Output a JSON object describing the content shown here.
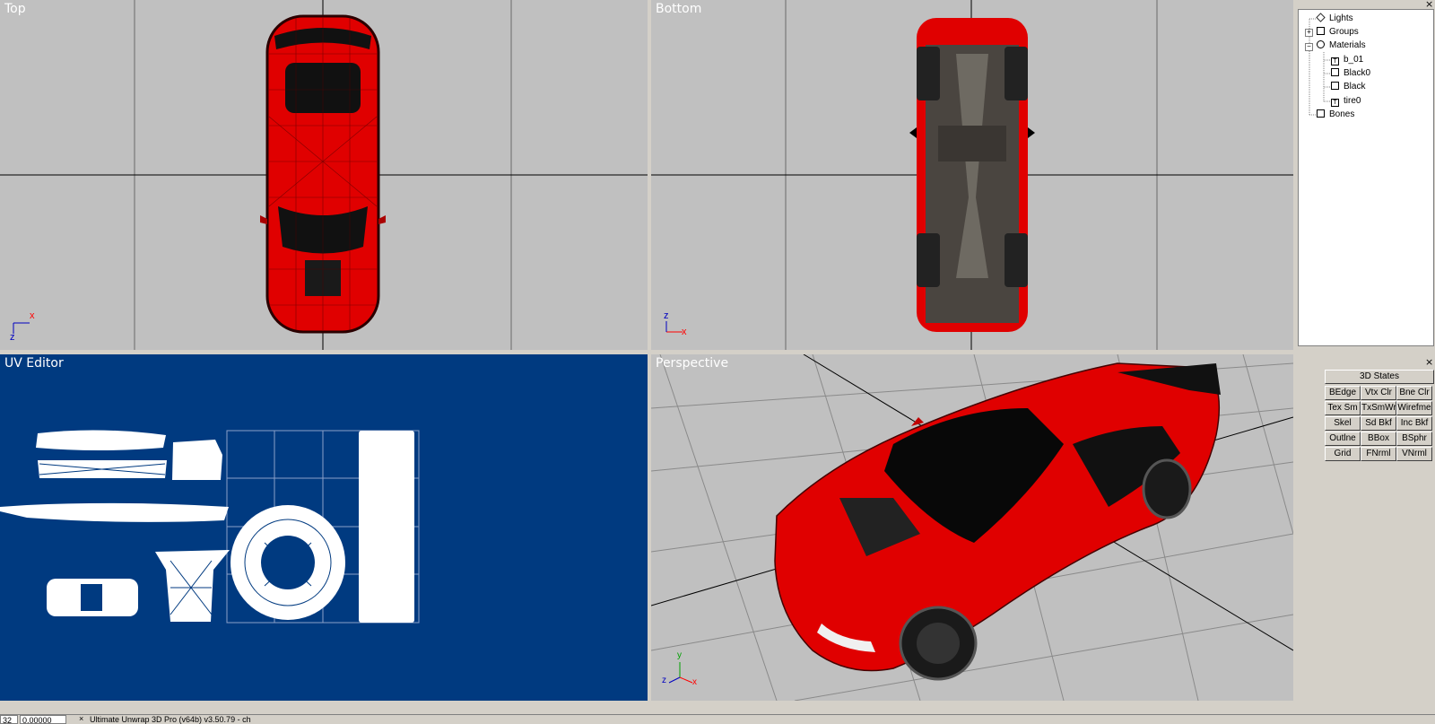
{
  "viewports": {
    "top": {
      "label": "Top"
    },
    "bottom": {
      "label": "Bottom"
    },
    "uv": {
      "label": "UV Editor"
    },
    "perspective": {
      "label": "Perspective"
    }
  },
  "axes": {
    "top": {
      "h": "x",
      "v": "z"
    },
    "bottom": {
      "h": "x",
      "v": "z"
    },
    "perspective": {
      "y": "y",
      "z": "z",
      "x": "x"
    }
  },
  "scene_tree": {
    "items": [
      {
        "label": "Lights",
        "icon": "light-icon"
      },
      {
        "label": "Groups",
        "icon": "groups-icon"
      },
      {
        "label": "Materials",
        "icon": "materials-icon"
      },
      {
        "label": "b_01",
        "icon": "texture-icon",
        "glyph": "T"
      },
      {
        "label": "Black0",
        "icon": "material-icon"
      },
      {
        "label": "Black",
        "icon": "material-icon"
      },
      {
        "label": "tire0",
        "icon": "texture-icon",
        "glyph": "T"
      },
      {
        "label": "Bones",
        "icon": "bones-icon"
      }
    ],
    "expander_plus": "+",
    "expander_minus": "−"
  },
  "states_panel": {
    "title": "3D States",
    "buttons": [
      "BEdge",
      "Vtx Clr",
      "Bne Clr",
      "Tex Sm",
      "TxSmWr",
      "Wirefme",
      "Skel",
      "Sd Bkf",
      "Inc Bkf",
      "Outlne",
      "BBox",
      "BSphr",
      "Grid",
      "FNrml",
      "VNrml"
    ]
  },
  "close_glyph": "×",
  "status_bar": {
    "cell1": "32",
    "cell2": "0.00000",
    "cell3": "Ultimate Unwrap 3D Pro (v64b) v3.50.79 - ch"
  },
  "colors": {
    "viewport_bg": "#c0c0c0",
    "uv_bg": "#003a80",
    "car_red": "#e00000",
    "axis_red": "#ff0000",
    "axis_blue": "#0000c0",
    "axis_green": "#00a000"
  }
}
